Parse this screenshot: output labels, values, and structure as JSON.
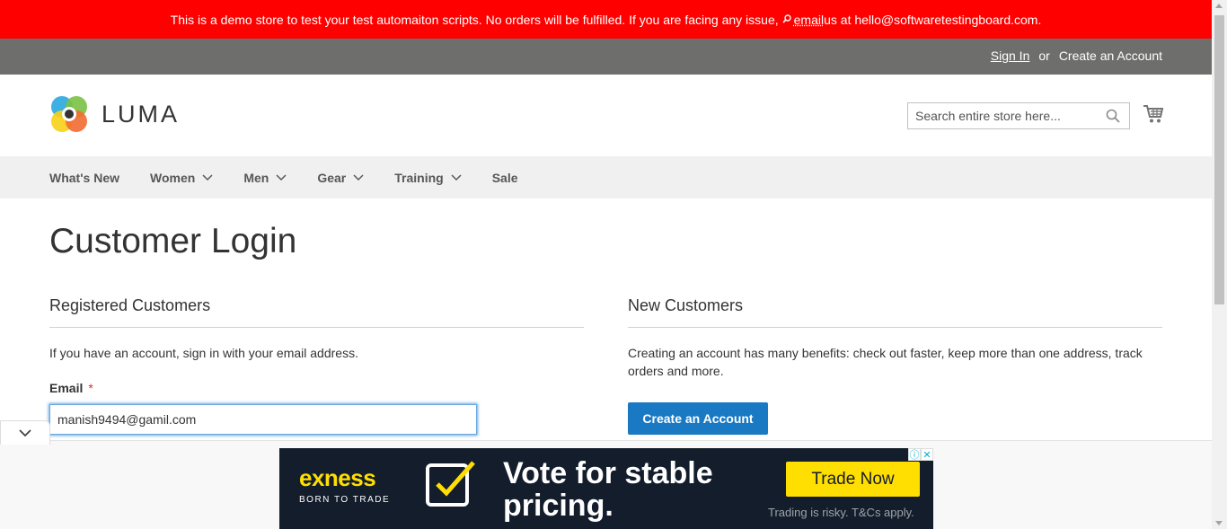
{
  "banner": {
    "text_before": "This is a demo store to test your test automaiton scripts. No orders will be fulfilled. If you are facing any issue,",
    "email_word": "email",
    "text_after": " us at hello@softwaretestingboard.com."
  },
  "topbar": {
    "sign_in": "Sign In",
    "or": "or",
    "create_account": "Create an Account"
  },
  "header": {
    "logo_text": "LUMA",
    "search_placeholder": "Search entire store here...",
    "icons": [
      "search-icon",
      "cart-icon"
    ]
  },
  "nav": {
    "items": [
      {
        "label": "What's New",
        "has_dropdown": false
      },
      {
        "label": "Women",
        "has_dropdown": true
      },
      {
        "label": "Men",
        "has_dropdown": true
      },
      {
        "label": "Gear",
        "has_dropdown": true
      },
      {
        "label": "Training",
        "has_dropdown": true
      },
      {
        "label": "Sale",
        "has_dropdown": false
      }
    ]
  },
  "page": {
    "title": "Customer Login"
  },
  "registered": {
    "title": "Registered Customers",
    "text": "If you have an account, sign in with your email address.",
    "email_label": "Email",
    "required_mark": "*",
    "email_value": "manish9494@gamil.com"
  },
  "new_customers": {
    "title": "New Customers",
    "text": "Creating an account has many benefits: check out faster, keep more than one address, track orders and more.",
    "button": "Create an Account"
  },
  "ad": {
    "brand": "exness",
    "tagline": "BORN TO TRADE",
    "headline": "Vote for stable pricing.",
    "cta": "Trade Now",
    "disclaimer": "Trading is risky. T&Cs apply.",
    "colors": {
      "background": "#141d2b",
      "accent": "#ffde02"
    }
  },
  "colors": {
    "banner": "#ff0000",
    "topbar": "#6e6e6c",
    "primary_button": "#1979c3"
  }
}
